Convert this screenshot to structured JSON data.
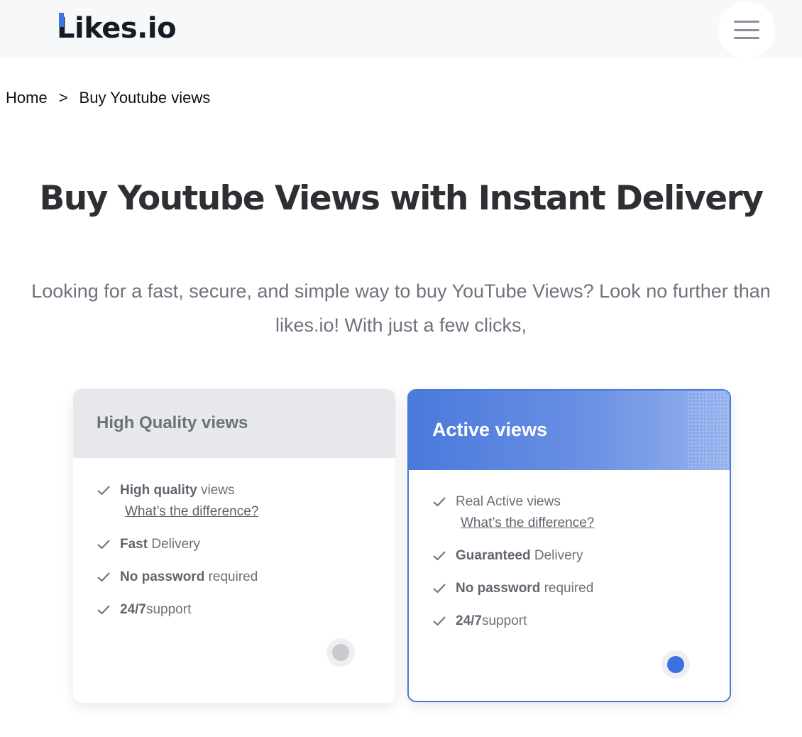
{
  "header": {
    "logo_text": "Likes.io",
    "accent_color": "#3f73e0"
  },
  "breadcrumb": {
    "home": "Home",
    "separator": ">",
    "current": "Buy Youtube views"
  },
  "main": {
    "title": "Buy Youtube Views with Instant Delivery",
    "intro": "Looking for a fast, secure, and simple way to buy YouTube Views? Look no further than likes.io! With just a few clicks,"
  },
  "cards": [
    {
      "title": "High Quality views",
      "selected": false,
      "features": [
        {
          "bold": "High quality",
          "text": " views",
          "link": "What’s the difference?"
        },
        {
          "bold": "Fast",
          "text": " Delivery"
        },
        {
          "bold": "No password",
          "text": " required"
        },
        {
          "bold": "24/7",
          "text": "support"
        }
      ]
    },
    {
      "title": "Active views",
      "selected": true,
      "features": [
        {
          "bold": "",
          "text": "Real Active views",
          "link": "What’s the difference?"
        },
        {
          "bold": "Guaranteed",
          "text": " Delivery"
        },
        {
          "bold": "No password",
          "text": " required"
        },
        {
          "bold": "24/7",
          "text": "support"
        }
      ]
    }
  ],
  "colors": {
    "primary_blue": "#4a79da",
    "muted_text": "#6e737c",
    "title_text": "#2d2f33"
  }
}
